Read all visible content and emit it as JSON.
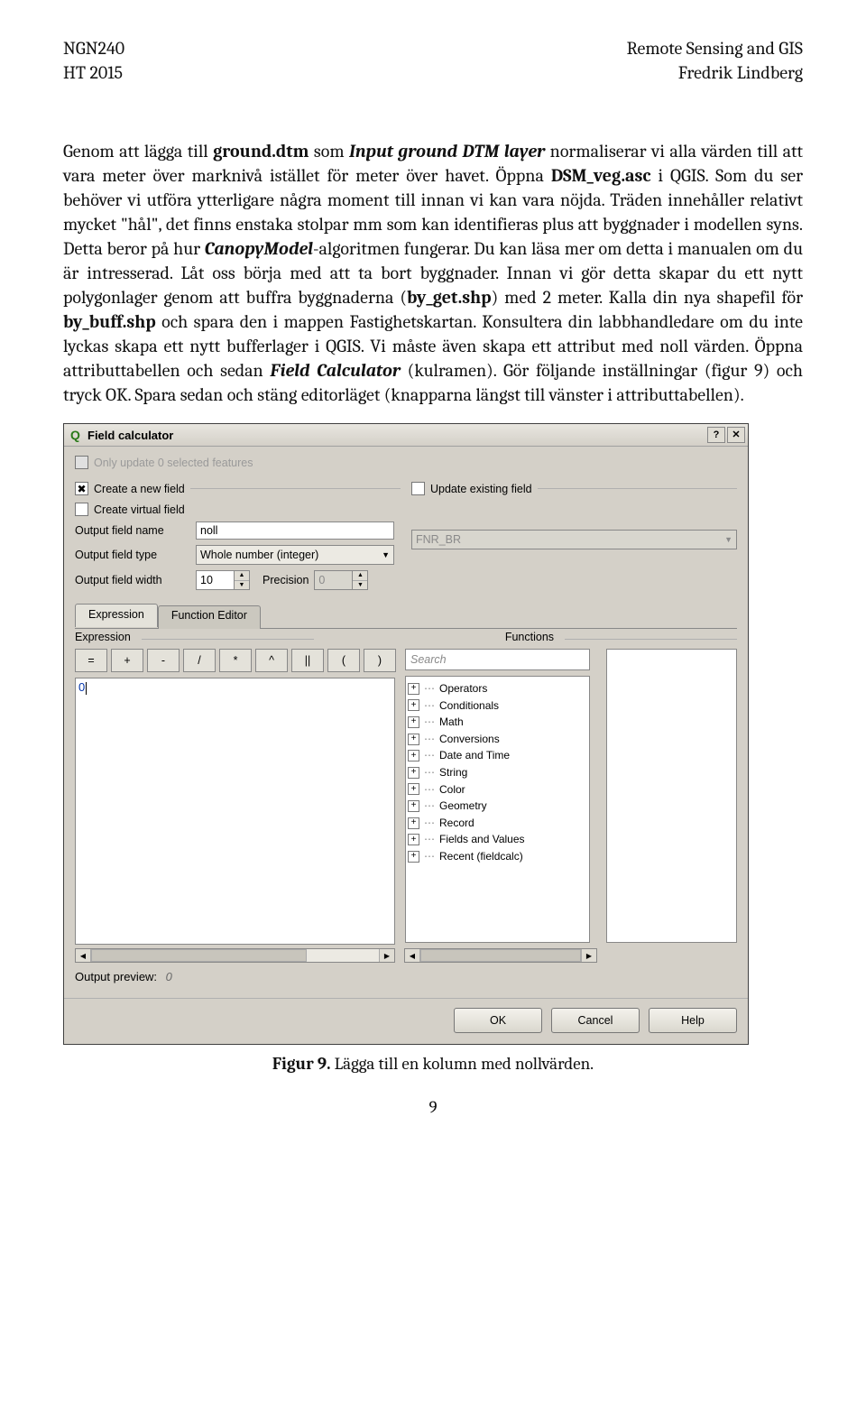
{
  "header": {
    "left1": "NGN240",
    "left2": "HT 2015",
    "right1": "Remote Sensing and GIS",
    "right2": "Fredrik Lindberg"
  },
  "body": {
    "p1a": "Genom att lägga till ",
    "p1b": "ground.dtm",
    "p1c": " som ",
    "p1d": "Input ground DTM layer",
    "p1e": " normaliserar vi alla värden till att vara meter över marknivå istället för meter över havet. Öppna ",
    "p1f": "DSM_veg.asc",
    "p1g": " i QGIS. Som du ser behöver vi utföra ytterligare några moment till innan vi kan vara nöjda. Träden innehåller relativt mycket \"hål\", det finns enstaka stolpar mm som kan identifieras plus att byggnader i modellen syns. Detta beror på hur ",
    "p1h": "CanopyModel",
    "p1i": "-algoritmen fungerar. Du kan läsa mer om detta i manualen om du är intresserad. Låt oss börja med att ta bort byggnader. Innan vi gör detta skapar du ett nytt polygonlager genom att buffra byggnaderna (",
    "p1j": "by_get.shp",
    "p1k": ") med 2 meter. Kalla din nya shapefil för ",
    "p1l": "by_buff.shp",
    "p1m": " och spara den i mappen Fastighetskartan. Konsultera din labbhandledare om du inte lyckas skapa ett nytt bufferlager i QGIS. Vi måste även skapa ett attribut med noll värden. Öppna attributtabellen och sedan ",
    "p1n": "Field Calculator",
    "p1o": " (kulramen). Gör följande inställningar (figur 9) och tryck OK. Spara sedan och stäng editorläget (knapparna längst till vänster i attributtabellen)."
  },
  "dlg": {
    "title": "Field calculator",
    "only_update": "Only update 0 selected features",
    "create_new": "Create a new field",
    "update_existing": "Update existing field",
    "create_virtual": "Create virtual field",
    "out_name_lbl": "Output field name",
    "out_name_val": "noll",
    "out_type_lbl": "Output field type",
    "out_type_val": "Whole number (integer)",
    "out_width_lbl": "Output field width",
    "out_width_val": "10",
    "precision_lbl": "Precision",
    "precision_val": "0",
    "existing_field_val": "FNR_BR",
    "tab_expression": "Expression",
    "tab_fneditor": "Function Editor",
    "sect_expression": "Expression",
    "sect_functions": "Functions",
    "ops": [
      "=",
      "+",
      "-",
      "/",
      "*",
      "^",
      "||",
      "(",
      ")"
    ],
    "expr_text": "0",
    "search_placeholder": "Search",
    "tree": [
      "Operators",
      "Conditionals",
      "Math",
      "Conversions",
      "Date and Time",
      "String",
      "Color",
      "Geometry",
      "Record",
      "Fields and Values",
      "Recent (fieldcalc)"
    ],
    "preview_lbl": "Output preview:",
    "preview_val": "0",
    "btn_ok": "OK",
    "btn_cancel": "Cancel",
    "btn_help": "Help"
  },
  "caption": {
    "label": "Figur 9.",
    "text": " Lägga till en kolumn med nollvärden."
  },
  "pagenum": "9"
}
